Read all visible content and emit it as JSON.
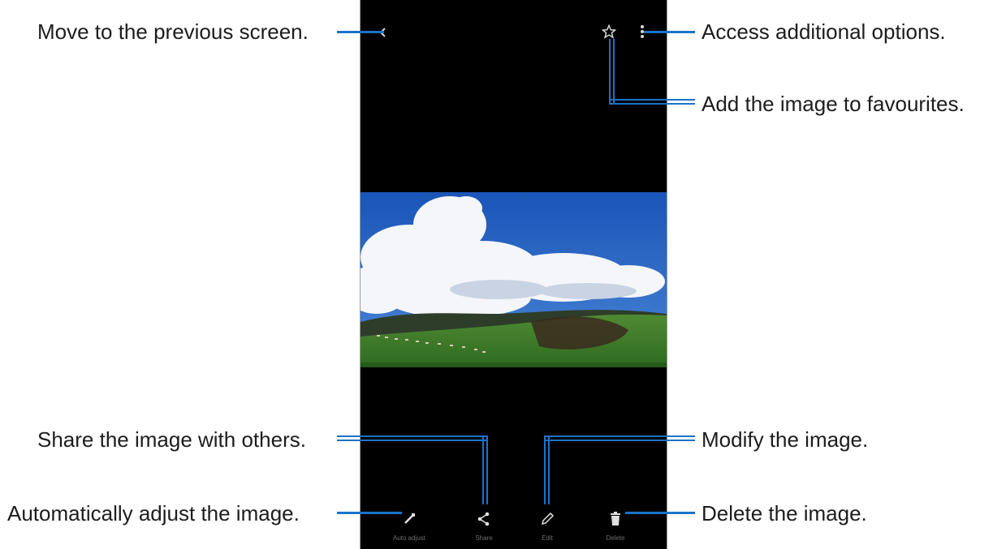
{
  "callouts": {
    "back": "Move to the previous screen.",
    "more": "Access additional options.",
    "favourite": "Add the image to favourites.",
    "share": "Share the image with others.",
    "edit": "Modify the image.",
    "auto_adjust": "Automatically adjust the image.",
    "delete": "Delete the image."
  },
  "toolbar": {
    "auto_adjust_label": "Auto adjust",
    "share_label": "Share",
    "edit_label": "Edit",
    "delete_label": "Delete"
  },
  "icons": {
    "back": "chevron-left-icon",
    "favourite": "star-icon",
    "more": "more-vert-icon",
    "auto_adjust": "magic-wand-icon",
    "share": "share-icon",
    "edit": "pencil-icon",
    "delete": "trash-icon"
  },
  "colors": {
    "callout_line": "#1a73c9",
    "screen_background": "#000000"
  }
}
